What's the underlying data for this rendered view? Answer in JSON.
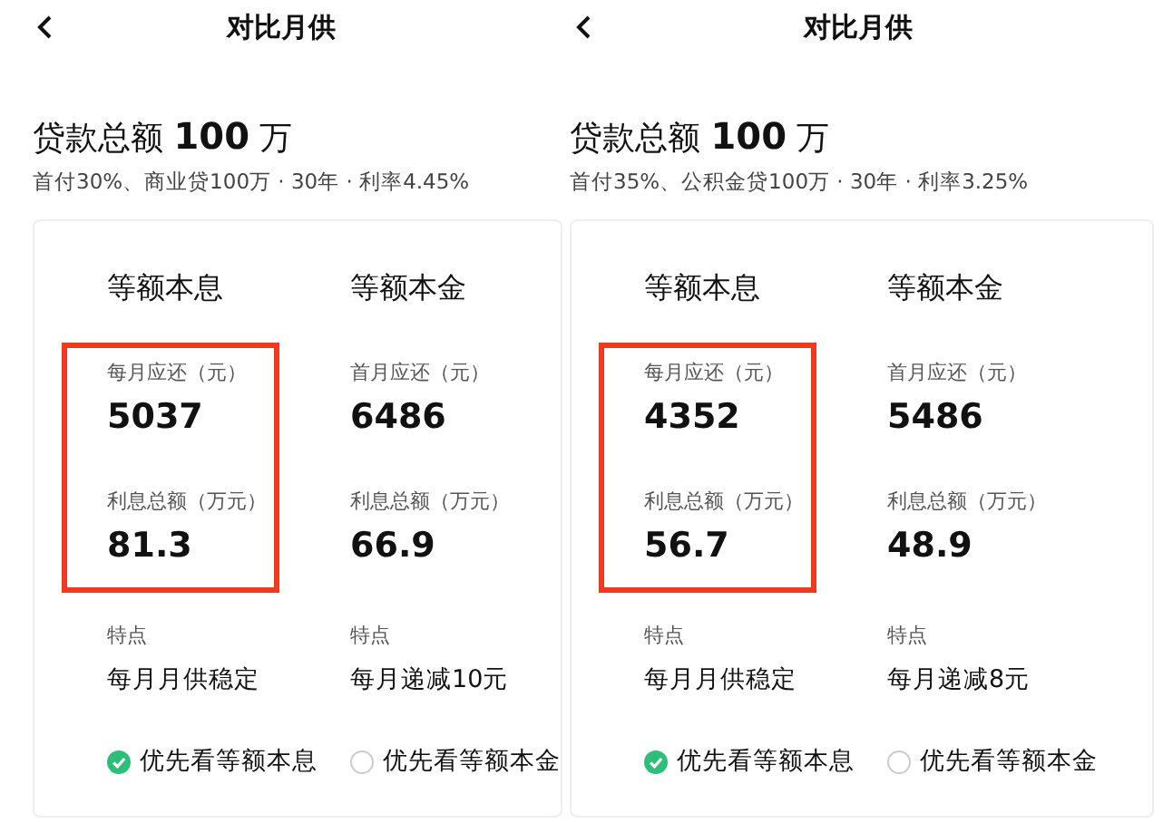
{
  "panels": [
    {
      "title": "对比月供",
      "loan_heading": "贷款总额 **100** 万",
      "subtitle": "首付30%、商业贷100万 · 30年 · 利率4.45%",
      "columns": [
        {
          "method": "等额本息",
          "highlighted": true,
          "rows": [
            {
              "label": "每月应还（元）",
              "value": "5037"
            },
            {
              "label": "利息总额（万元）",
              "value": "81.3"
            }
          ],
          "feature_label": "特点",
          "feature": "每月月供稳定",
          "option": {
            "label": "优先看等额本息",
            "selected": true
          }
        },
        {
          "method": "等额本金",
          "highlighted": false,
          "rows": [
            {
              "label": "首月应还（元）",
              "value": "6486"
            },
            {
              "label": "利息总额（万元）",
              "value": "66.9"
            }
          ],
          "feature_label": "特点",
          "feature": "每月递减10元",
          "option": {
            "label": "优先看等额本金",
            "selected": false
          }
        }
      ]
    },
    {
      "title": "对比月供",
      "loan_heading": "贷款总额 **100** 万",
      "subtitle": "首付35%、公积金贷100万 · 30年 · 利率3.25%",
      "columns": [
        {
          "method": "等额本息",
          "highlighted": true,
          "rows": [
            {
              "label": "每月应还（元）",
              "value": "4352"
            },
            {
              "label": "利息总额（万元）",
              "value": "56.7"
            }
          ],
          "feature_label": "特点",
          "feature": "每月月供稳定",
          "option": {
            "label": "优先看等额本息",
            "selected": true
          }
        },
        {
          "method": "等额本金",
          "highlighted": false,
          "rows": [
            {
              "label": "首月应还（元）",
              "value": "5486"
            },
            {
              "label": "利息总额（万元）",
              "value": "48.9"
            }
          ],
          "feature_label": "特点",
          "feature": "每月递减8元",
          "option": {
            "label": "优先看等额本金",
            "selected": false
          }
        }
      ]
    }
  ]
}
